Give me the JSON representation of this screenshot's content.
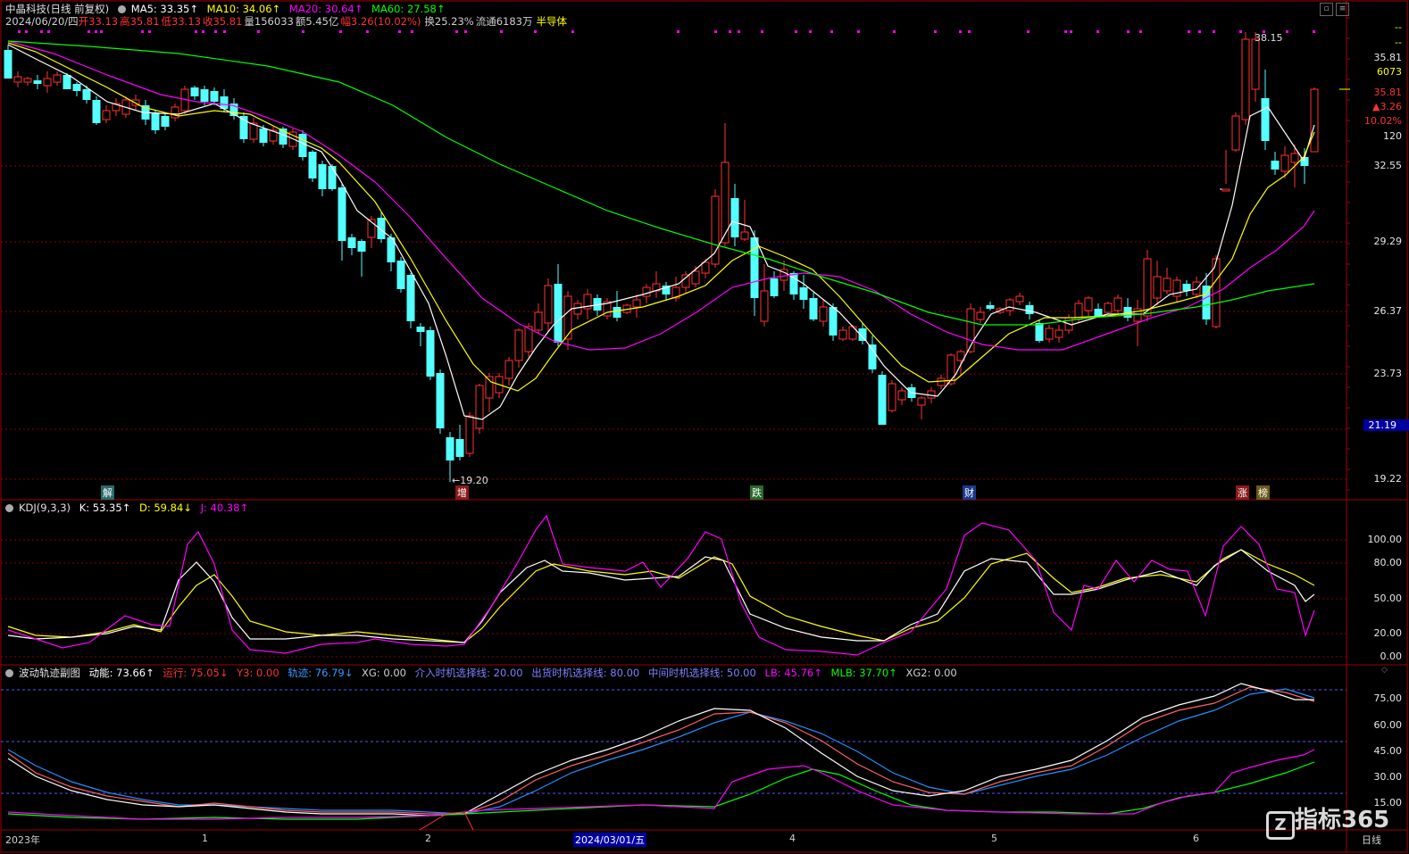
{
  "header": {
    "stock_title": "中晶科技(日线 前复权)",
    "ma5": "MA5: 33.35↑",
    "ma10": "MA10: 34.06↑",
    "ma20": "MA20: 30.64↑",
    "ma60": "MA60: 27.58↑",
    "date": "2024/06/20/四",
    "open": "开33.13",
    "high": "高35.81",
    "low": "低33.13",
    "close": "收35.81",
    "volume": "量156033",
    "amount": "额5.45亿",
    "change": "幅3.26(10.02%)",
    "turnover": "换25.23%",
    "float": "流通6183万",
    "sector": "半导体"
  },
  "price_axis": {
    "dashes1": "--",
    "dashes2": "--",
    "last": "35.81",
    "vol": "6073",
    "price2": "35.81",
    "chg": "▲3.26",
    "pct": "10.02%",
    "n": "120",
    "ticks": [
      "32.55",
      "29.29",
      "26.37",
      "23.73",
      "21.19",
      "19.22"
    ],
    "highlight_tick": "21.19"
  },
  "annotations": {
    "high": "38.15",
    "low": "←19.20",
    "event_tags": [
      "解",
      "增",
      "跌",
      "财",
      "涨",
      "榜"
    ]
  },
  "kdj": {
    "title": "KDJ(9,3,3)",
    "k": "K: 53.35↑",
    "d": "D: 59.84↓",
    "j": "J: 40.38↑",
    "ticks": [
      "100.00",
      "80.00",
      "50.00",
      "20.00",
      "0.00"
    ]
  },
  "wave": {
    "title": "波动轨迹副图",
    "dongneng": "动能: 73.66↑",
    "yunxing": "运行: 75.05↓",
    "y3": "Y3: 0.00",
    "guiji": "轨迹: 76.79↓",
    "xg": "XG: 0.00",
    "jieru": "介入时机选择线: 20.00",
    "chuhuo": "出货时机选择线: 80.00",
    "zhongjian": "中间时机选择线: 50.00",
    "lb": "LB: 45.76↑",
    "mlb": "MLB: 37.70↑",
    "xg2": "XG2: 0.00",
    "ticks": [
      "75.00",
      "60.00",
      "45.00",
      "30.00",
      "15.00"
    ]
  },
  "x_axis": {
    "labels": [
      "2023年",
      "1",
      "2",
      "2024/03/01/五",
      "4",
      "5",
      "6"
    ],
    "period": "日线"
  },
  "watermark": "指标365",
  "colors": {
    "up": "#ff3232",
    "down": "#54ffff",
    "ma5": "#ffffff",
    "ma10": "#ffff00",
    "ma20": "#ff00ff",
    "ma60": "#00ff00",
    "grid": "#8b0000",
    "border": "#a00000"
  }
}
